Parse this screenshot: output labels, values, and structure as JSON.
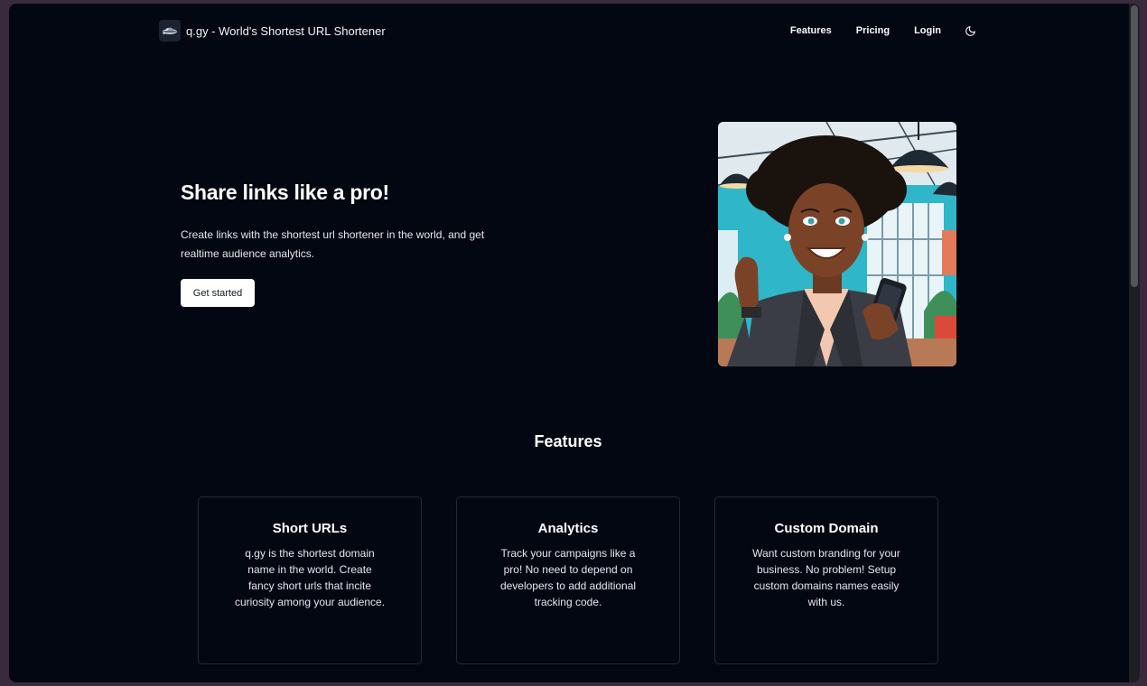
{
  "header": {
    "brand": "q.gy - World's Shortest URL Shortener",
    "nav": [
      "Features",
      "Pricing",
      "Login"
    ],
    "theme_icon": "moon-icon"
  },
  "hero": {
    "title": "Share links like a pro!",
    "description": "Create links with the shortest url shortener in the world, and get realtime audience analytics.",
    "cta": "Get started",
    "image": "illustration of smiling woman with afro holding phone in bright office"
  },
  "features": {
    "title": "Features",
    "cards": [
      {
        "title": "Short URLs",
        "description": "q.gy is the shortest domain name in the world. Create fancy short urls that incite curiosity among your audience."
      },
      {
        "title": "Analytics",
        "description": "Track your campaigns like a pro! No need to depend on developers to add additional tracking code."
      },
      {
        "title": "Custom Domain",
        "description": "Want custom branding for your business. No problem! Setup custom domains names easily with us."
      }
    ]
  },
  "colors": {
    "background": "#030712",
    "text": "#ffffff",
    "card_border": "#1f2937",
    "button_bg": "#ffffff"
  }
}
